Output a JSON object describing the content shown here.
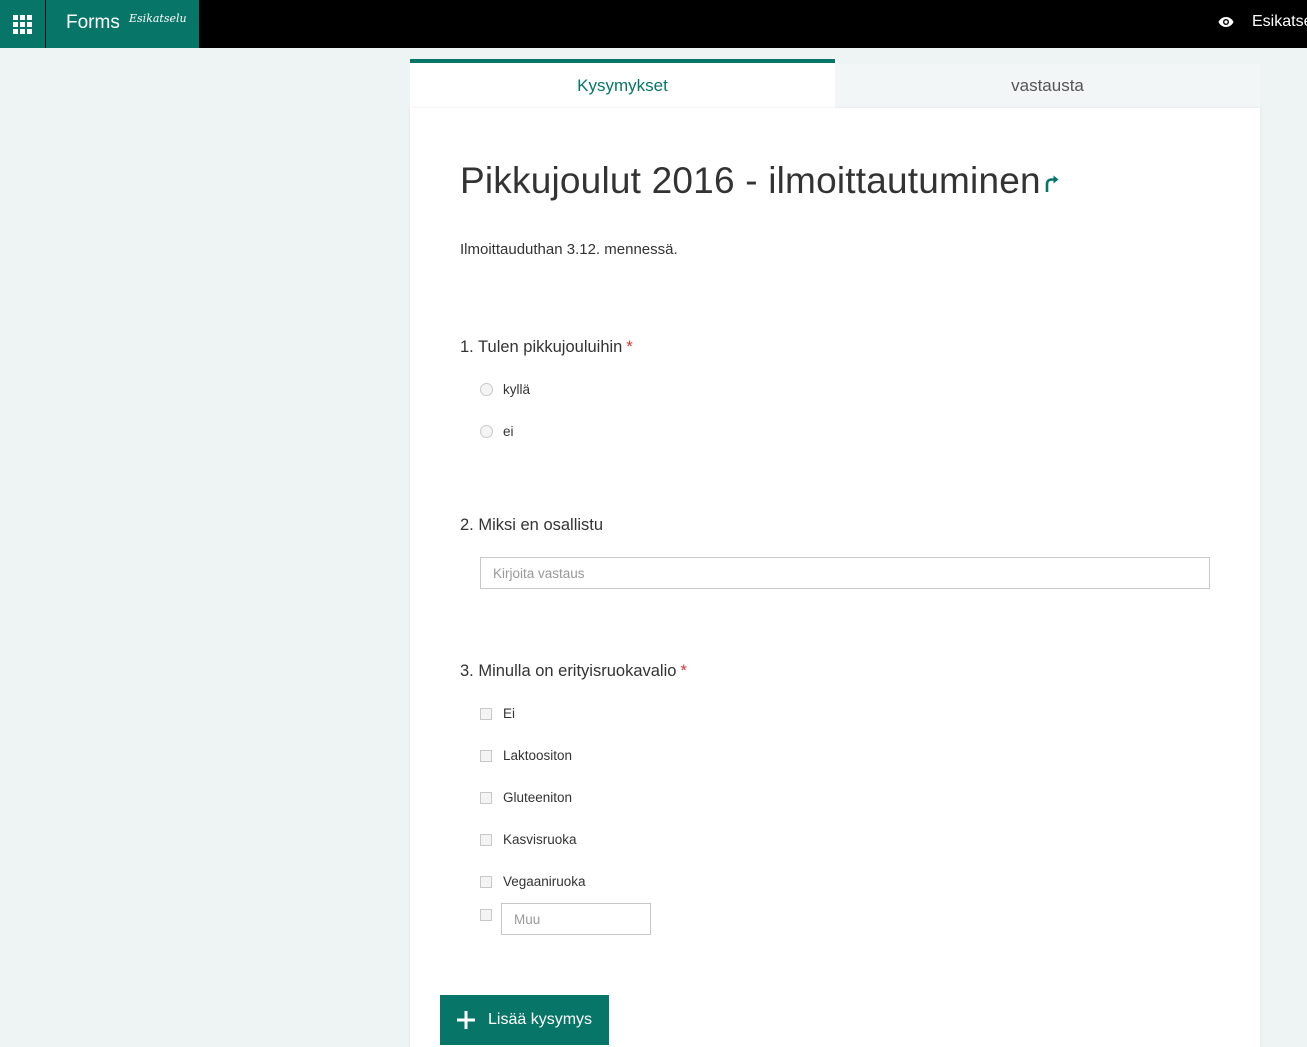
{
  "header": {
    "app_name": "Forms",
    "app_badge": "Esikatselu",
    "preview_label": "Esikatse",
    "accent_color": "#077568",
    "icons": {
      "launcher": "waffle-icon",
      "preview": "eye-icon"
    }
  },
  "tabs": [
    {
      "label": "Kysymykset",
      "active": true
    },
    {
      "label": "vastausta",
      "active": false
    }
  ],
  "form": {
    "title": "Pikkujoulut 2016 - ilmoittautuminen",
    "description": "Ilmoittauduthan 3.12. mennessä.",
    "share_icon": "share-arrow-icon",
    "questions": [
      {
        "label": "1. Tulen pikkujouluihin",
        "required": "*",
        "type": "radio",
        "options": [
          "kyllä",
          "ei"
        ]
      },
      {
        "label": "2. Miksi en osallistu",
        "type": "text",
        "placeholder": "Kirjoita vastaus"
      },
      {
        "label": "3. Minulla on erityisruokavalio",
        "required": "*",
        "type": "checkbox",
        "options": [
          "Ei",
          "Laktoositon",
          "Gluteeniton",
          "Kasvisruoka",
          "Vegaaniruoka"
        ],
        "other_placeholder": "Muu"
      }
    ]
  },
  "add_button": {
    "label": "Lisää kysymys",
    "icon": "plus-icon"
  }
}
